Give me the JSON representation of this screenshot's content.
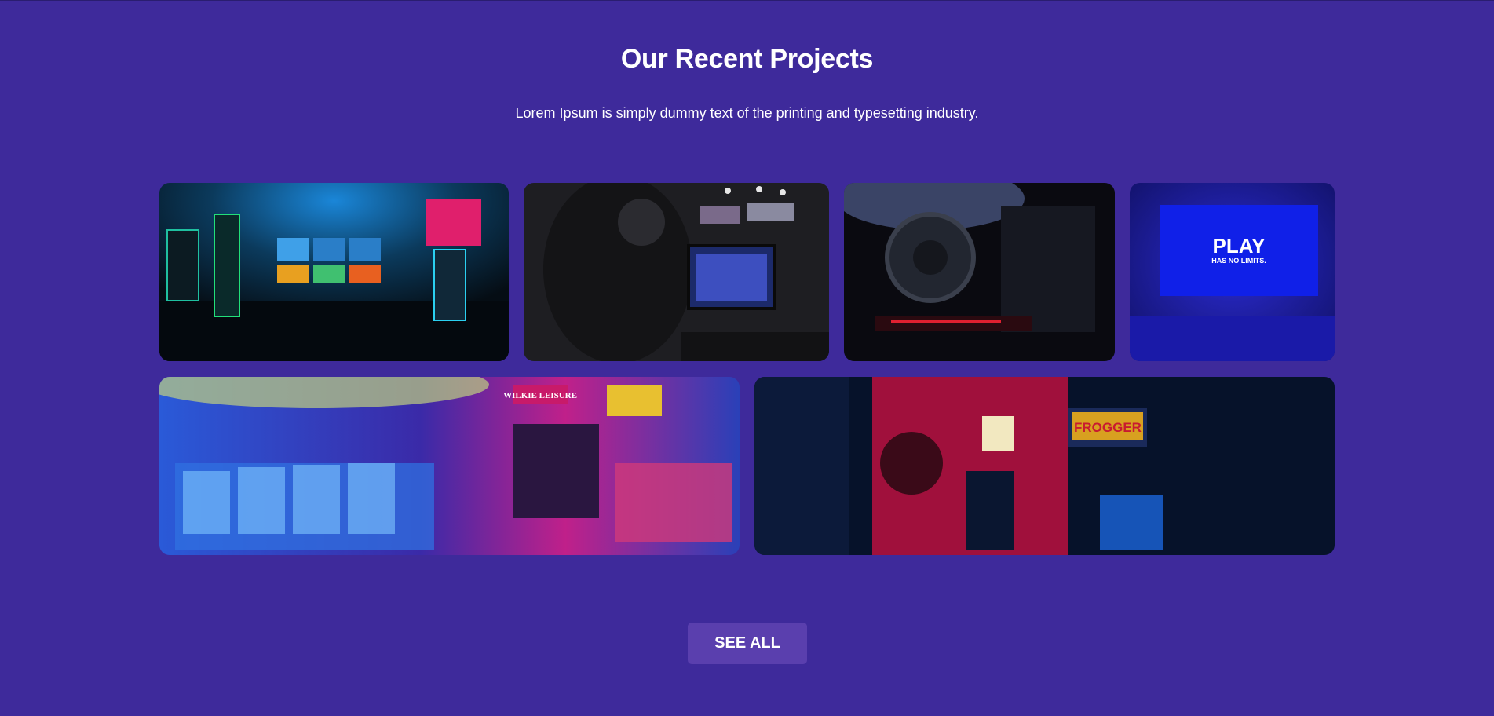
{
  "section": {
    "title": "Our Recent Projects",
    "subtitle": "Lorem Ipsum is simply dummy text of the printing and typesetting industry."
  },
  "gallery": {
    "tiles": [
      {
        "subject": "arcade cabinets in a dark neon room"
      },
      {
        "subject": "gamer with headset at monitors"
      },
      {
        "subject": "PC case interior with cooler"
      },
      {
        "subject": "blue screen",
        "screen_title": "PLAY",
        "screen_subtitle": "HAS NO LIMITS."
      },
      {
        "subject": "neon arcade with claw machines",
        "sign_text": "WILKIE LEISURE"
      },
      {
        "subject": "red-lit arcade cabinet",
        "marquee_text": "FROGGER"
      }
    ]
  },
  "cta": {
    "label": "SEE ALL"
  },
  "colors": {
    "background": "#3e2a9b",
    "button": "#5a3fae"
  }
}
